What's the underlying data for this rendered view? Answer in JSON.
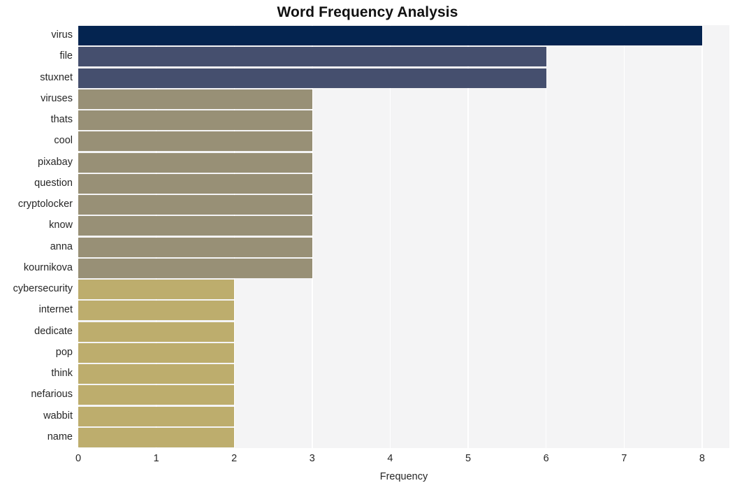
{
  "chart_data": {
    "type": "bar",
    "orientation": "horizontal",
    "title": "Word Frequency Analysis",
    "xlabel": "Frequency",
    "ylabel": "",
    "xlim": [
      0,
      8.35
    ],
    "xticks": [
      "0",
      "1",
      "2",
      "3",
      "4",
      "5",
      "6",
      "7",
      "8"
    ],
    "xtick_values": [
      0,
      1,
      2,
      3,
      4,
      5,
      6,
      7,
      8
    ],
    "grid": "vertical-white",
    "legend": "none",
    "categories": [
      "virus",
      "file",
      "stuxnet",
      "viruses",
      "thats",
      "cool",
      "pixabay",
      "question",
      "cryptolocker",
      "know",
      "anna",
      "kournikova",
      "cybersecurity",
      "internet",
      "dedicate",
      "pop",
      "think",
      "nefarious",
      "wabbit",
      "name"
    ],
    "values": [
      8,
      6,
      6,
      3,
      3,
      3,
      3,
      3,
      3,
      3,
      3,
      3,
      2,
      2,
      2,
      2,
      2,
      2,
      2,
      2
    ],
    "bar_colors": [
      "#042450",
      "#454f6e",
      "#454f6e",
      "#989076",
      "#989076",
      "#989076",
      "#989076",
      "#989076",
      "#989076",
      "#989076",
      "#989076",
      "#989076",
      "#bdad6d",
      "#bdad6d",
      "#bdad6d",
      "#bdad6d",
      "#bdad6d",
      "#bdad6d",
      "#bdad6d",
      "#bdad6d"
    ]
  },
  "style": {
    "plot_background": "#f4f4f5",
    "gridline_color": "#ffffff",
    "figure_background": "#ffffff",
    "text_color": "#262626",
    "title_color": "#111111"
  }
}
